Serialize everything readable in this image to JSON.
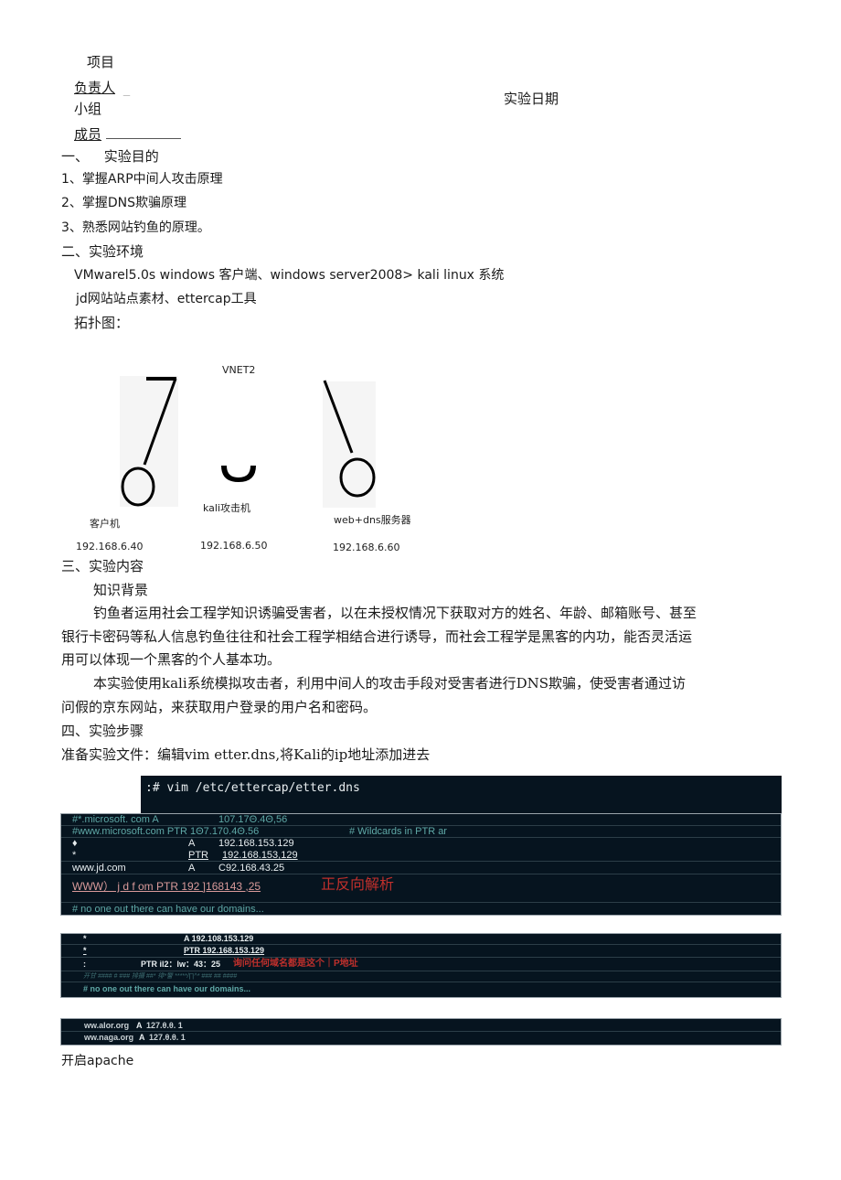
{
  "header": {
    "project_label": "项目",
    "owner_label": "负责人",
    "owner_blank": "_",
    "group_label": "小组",
    "members_label": "成员",
    "date_label": "实验日期"
  },
  "section1": {
    "title_num": "一、",
    "title": "实验目的",
    "items": [
      "1、掌握ARP中间人攻击原理",
      "2、掌握DNS欺骗原理",
      "3、熟悉网站钓鱼的原理。"
    ]
  },
  "section2": {
    "title": "二、实验环境",
    "env_line": "VMwarel5.0s windows 客户端、windows server2008> kali linux 系统",
    "materials_line": "jd网站站点素材、ettercap工具",
    "topology_label": "拓扑图："
  },
  "topology": {
    "network_label": "VNET2",
    "nodes": [
      {
        "name": "客户机",
        "ip": "192.168.6.40"
      },
      {
        "name": "kali攻击机",
        "ip": "192.168.6.50"
      },
      {
        "name": "web+dns服务器",
        "ip": "192.168.6.60"
      }
    ]
  },
  "section3": {
    "title": "三、实验内容",
    "subtitle": "知识背景",
    "para1_line1": "钓鱼者运用社会工程学知识诱骗受害者，以在未授权情况下获取对方的姓名、年龄、邮箱账号、甚至",
    "para1_line2": "银行卡密码等私人信息钓鱼往往和社会工程学相结合进行诱导，而社会工程学是黑客的内功，能否灵活运",
    "para1_line3": "用可以体现一个黑客的个人基本功。",
    "para2_line1": "本实验使用kali系统模拟攻击者，利用中间人的攻击手段对受害者进行DNS欺骗，使受害者通过访",
    "para2_line2": "问假的京东网站，来获取用户登录的用户名和密码。"
  },
  "section4": {
    "title": "四、实验步骤",
    "step1": "准备实验文件：编辑vim etter.dns,将Kali的ip地址添加进去"
  },
  "terminal1": {
    "command": ":# vim /etc/ettercap/etter.dns",
    "rows": [
      {
        "c1": "#*.microsoft. com A",
        "c2": "",
        "c3": "107.17Θ.4Θ,56",
        "c4": ""
      },
      {
        "c1": "#www.microsoft.com PTR 1Θ7.170.4Θ.56",
        "c2": "",
        "c3": "",
        "c4": "# Wildcards in PTR ar"
      },
      {
        "c1": "♦",
        "c2": "A",
        "c3": "192.168.153.129",
        "c4": ""
      },
      {
        "c1": "*",
        "c2": "PTR",
        "c3": "192.168.153,129",
        "c4": ""
      },
      {
        "c1": "www.jd.com",
        "c2": "A",
        "c3": "C92.168.43.25",
        "c4": ""
      }
    ],
    "ptr_line": "WWW）  j d f om PTR 192 ]168143 ,25",
    "annotation": "正反向解析",
    "comment": "# no one out there can have our domains..."
  },
  "terminal2": {
    "rows": [
      {
        "c1": "*",
        "c2": "A 192.108.153.129"
      },
      {
        "c1": "*",
        "c2": "PTR 192.168.153.129"
      }
    ],
    "ptr_row": {
      "c1": ":",
      "c2": "PTR il2：lw：43：25",
      "annotation": "询问任何域名都是这个｜P地址"
    },
    "garbled_line": "开甘 #### # ### 排摄 ##* 徘*警 *****/∏^* ### ## ####",
    "comment": "# no one out there can have our domains..."
  },
  "terminal3": {
    "rows": [
      {
        "host": "ww.alor.org",
        "type": "A",
        "ip": "127.θ.θ. 1"
      },
      {
        "host": "ww.naga.org",
        "type": "A",
        "ip": "127.θ.θ. 1"
      }
    ]
  },
  "footer_step": "开启apache"
}
